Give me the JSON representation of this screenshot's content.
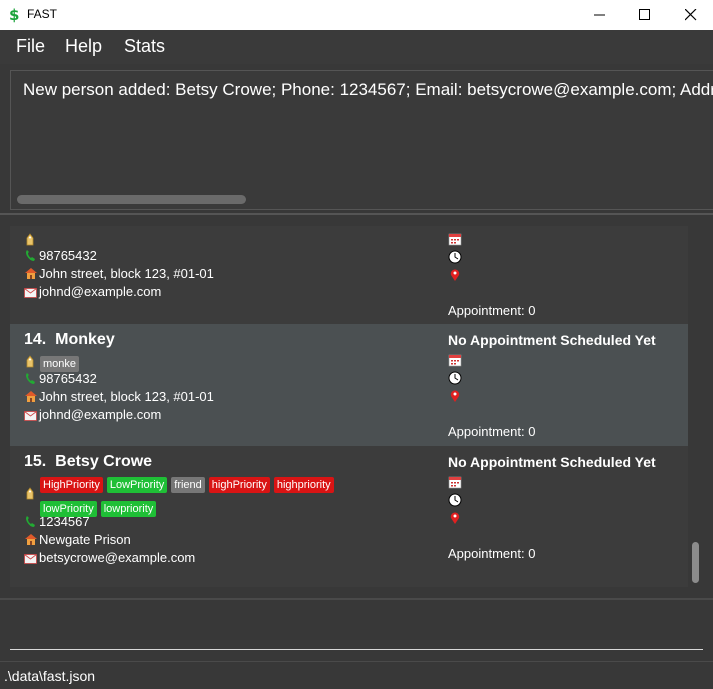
{
  "window": {
    "title": "FAST"
  },
  "menu": {
    "items": [
      "File",
      "Help",
      "Stats"
    ]
  },
  "result": {
    "text": "New person added: Betsy Crowe; Phone: 1234567; Email: betsycrowe@example.com; Address: Newgate Prison"
  },
  "persons": [
    {
      "index": "",
      "name": "",
      "tags": [],
      "phone": "98765432",
      "address": "John street, block 123, #01-01",
      "email": "johnd@example.com",
      "appointment_title": "",
      "appointment_count": "Appointment: 0"
    },
    {
      "index": "14.",
      "name": "Monkey",
      "tags": [
        {
          "label": "monke",
          "color": "grey"
        }
      ],
      "phone": "98765432",
      "address": "John street, block 123, #01-01",
      "email": "johnd@example.com",
      "appointment_title": "No Appointment Scheduled Yet",
      "appointment_count": "Appointment: 0"
    },
    {
      "index": "15.",
      "name": "Betsy Crowe",
      "tags": [
        {
          "label": "HighPriority",
          "color": "red"
        },
        {
          "label": "LowPriority",
          "color": "green"
        },
        {
          "label": "friend",
          "color": "grey"
        },
        {
          "label": "highPriority",
          "color": "red"
        },
        {
          "label": "highpriority",
          "color": "red"
        },
        {
          "label": "lowPriority",
          "color": "green"
        },
        {
          "label": "lowpriority",
          "color": "green"
        }
      ],
      "phone": "1234567",
      "address": "Newgate Prison",
      "email": "betsycrowe@example.com",
      "appointment_title": "No Appointment Scheduled Yet",
      "appointment_count": "Appointment: 0"
    }
  ],
  "command": {
    "value": ""
  },
  "status": {
    "path": ".\\data\\fast.json"
  },
  "colors": {
    "tag_red": "#d91414",
    "tag_green": "#1fbf36",
    "tag_grey": "#777777",
    "selected_row": "#4b5052",
    "background": "#383838"
  },
  "icons": [
    "dollar-icon",
    "minimize-icon",
    "maximize-icon",
    "close-icon",
    "tag-icon",
    "phone-icon",
    "home-icon",
    "email-icon",
    "calendar-icon",
    "clock-icon",
    "location-pin-icon"
  ]
}
